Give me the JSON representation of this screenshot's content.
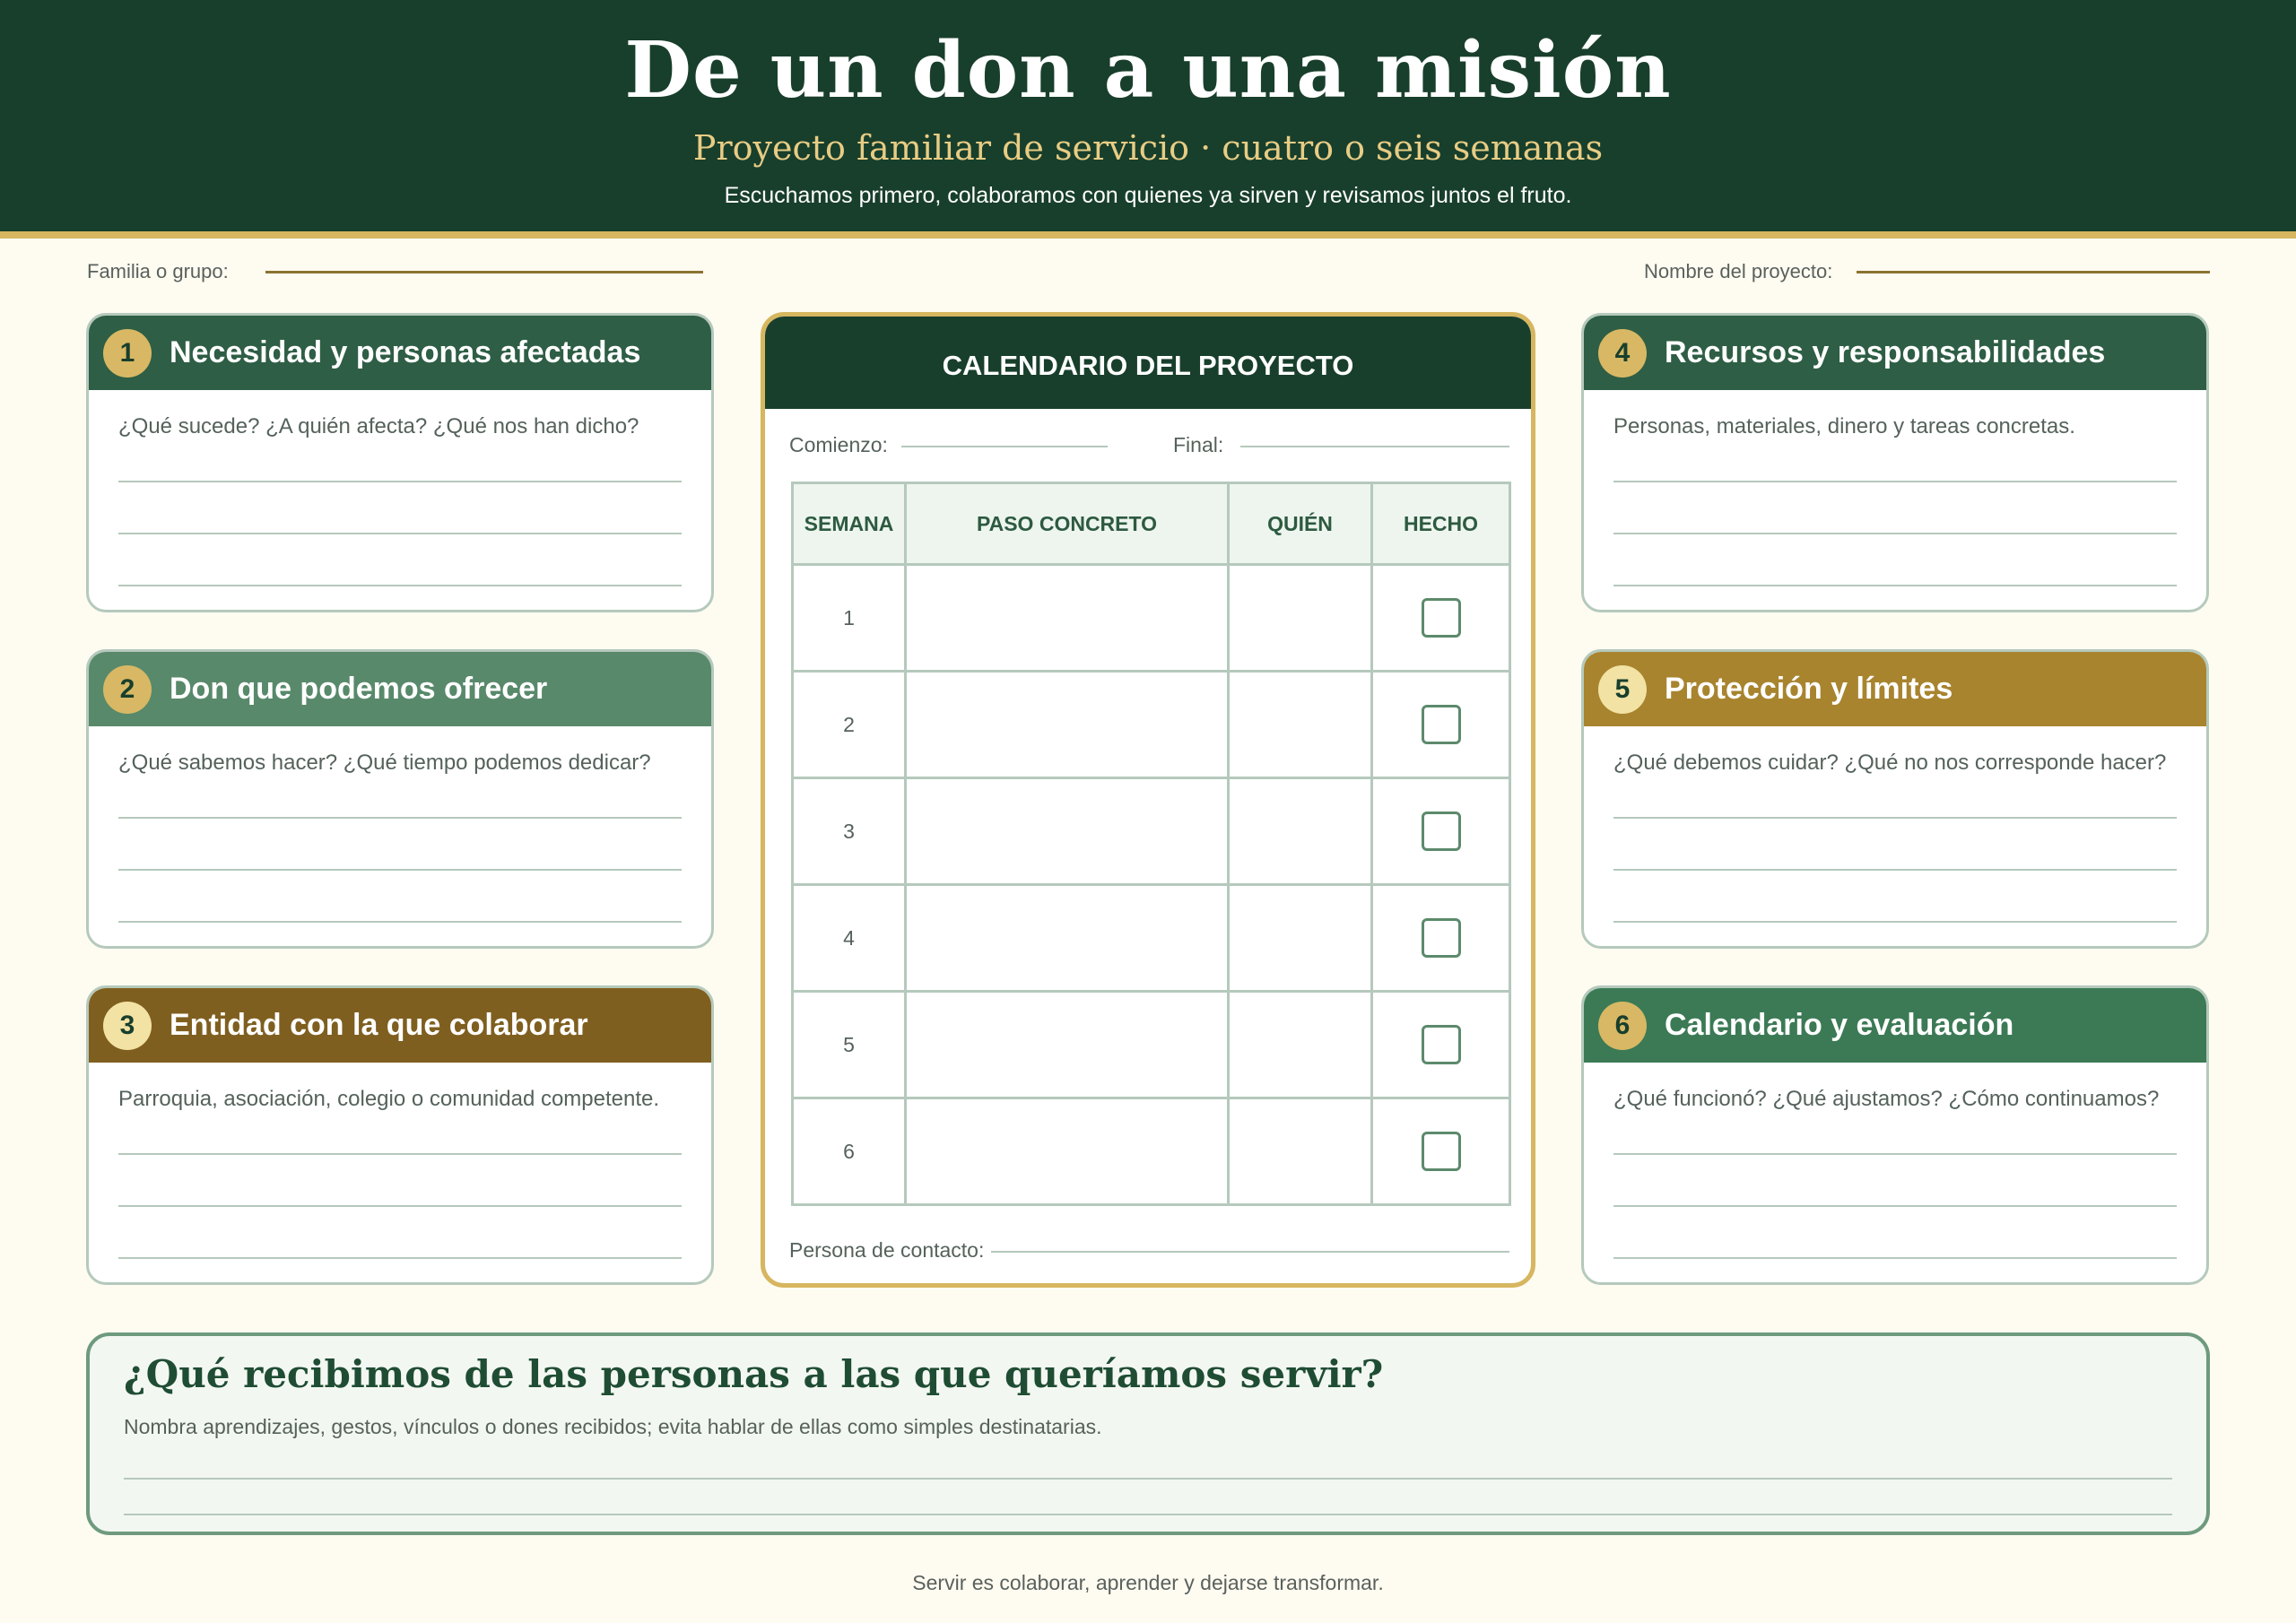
{
  "header": {
    "title": "De un don a una misión",
    "subtitle": "Proyecto familiar de servicio · cuatro o seis semanas",
    "tagline": "Escuchamos primero, colaboramos con quienes ya sirven y revisamos juntos el fruto."
  },
  "fields": {
    "family_label": "Familia o grupo:",
    "project_label": "Nombre del proyecto:"
  },
  "cards": [
    {
      "num": "1",
      "title": "Necesidad y personas afectadas",
      "prompt": "¿Qué sucede? ¿A quién afecta? ¿Qué nos han dicho?",
      "color": "#2e5e45"
    },
    {
      "num": "2",
      "title": "Don que podemos ofrecer",
      "prompt": "¿Qué sabemos hacer? ¿Qué tiempo podemos dedicar?",
      "color": "#58896b"
    },
    {
      "num": "3",
      "title": "Entidad con la que colaborar",
      "prompt": "Parroquia, asociación, colegio o comunidad competente.",
      "color": "#7f5f1f"
    },
    {
      "num": "4",
      "title": "Recursos y responsabilidades",
      "prompt": "Personas, materiales, dinero y tareas concretas.",
      "color": "#2e5e45"
    },
    {
      "num": "5",
      "title": "Protección y límites",
      "prompt": "¿Qué debemos cuidar? ¿Qué no nos corresponde hacer?",
      "color": "#a8842f"
    },
    {
      "num": "6",
      "title": "Calendario y evaluación",
      "prompt": "¿Qué funcionó? ¿Qué ajustamos? ¿Cómo continuamos?",
      "color": "#3b7a55"
    }
  ],
  "calendar": {
    "title": "CALENDARIO DEL PROYECTO",
    "start_label": "Comienzo:",
    "end_label": "Final:",
    "columns": [
      "SEMANA",
      "PASO CONCRETO",
      "QUIÉN",
      "HECHO"
    ],
    "weeks": [
      "1",
      "2",
      "3",
      "4",
      "5",
      "6"
    ],
    "contact_label": "Persona de contacto:"
  },
  "reflection": {
    "title": "¿Qué recibimos de las personas a las que queríamos servir?",
    "subtitle": "Nombra aprendizajes, gestos, vínculos o dones recibidos; evita hablar de ellas como simples destinatarias."
  },
  "footer": "Servir es colaborar, aprender y dejarse transformar."
}
